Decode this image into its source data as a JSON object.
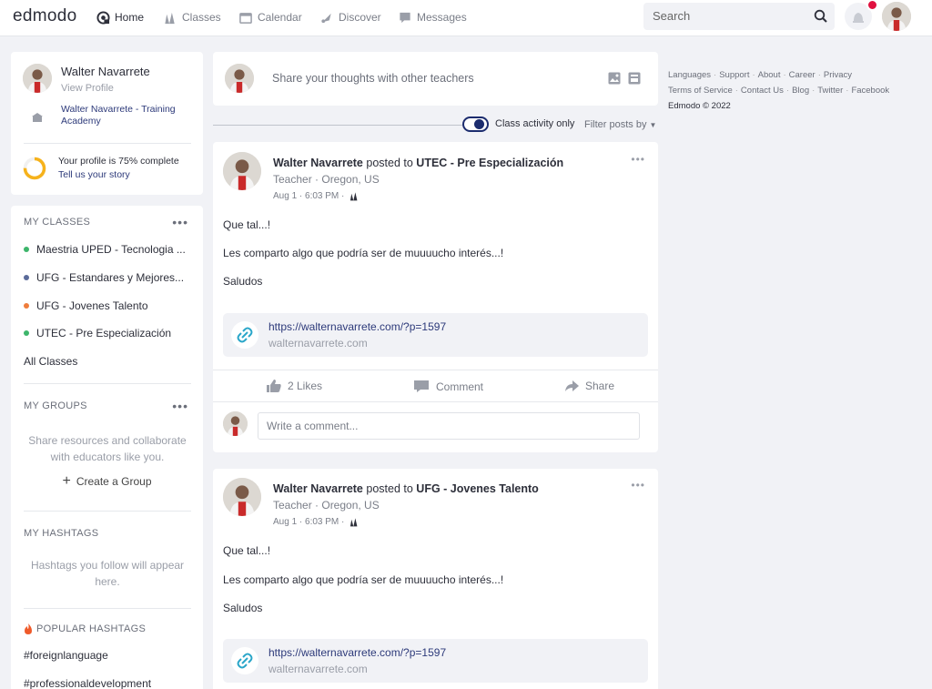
{
  "nav": {
    "logo": "edmodo",
    "items": [
      {
        "label": "Home",
        "icon": "home-icon"
      },
      {
        "label": "Classes",
        "icon": "classes-icon"
      },
      {
        "label": "Calendar",
        "icon": "calendar-icon"
      },
      {
        "label": "Discover",
        "icon": "discover-icon"
      },
      {
        "label": "Messages",
        "icon": "messages-icon"
      }
    ],
    "search_placeholder": "Search"
  },
  "profile": {
    "name": "Walter Navarrete",
    "view_profile": "View Profile",
    "school": "Walter Navarrete - Training Academy",
    "completion_text": "Your profile is 75% complete",
    "completion_percent": 75,
    "completion_cta": "Tell us your story"
  },
  "classes": {
    "title": "MY CLASSES",
    "items": [
      {
        "label": "Maestria UPED - Tecnologia ...",
        "color": "#3db56b"
      },
      {
        "label": "UFG - Estandares y Mejores...",
        "color": "#5b6b9a"
      },
      {
        "label": "UFG - Jovenes Talento",
        "color": "#ef7d3c"
      },
      {
        "label": "UTEC - Pre Especialización",
        "color": "#3db56b"
      }
    ],
    "all_label": "All Classes"
  },
  "groups": {
    "title": "MY GROUPS",
    "empty_text": "Share resources and collaborate with educators like you.",
    "create_label": "Create a Group"
  },
  "hashtags": {
    "title": "MY HASHTAGS",
    "empty_text": "Hashtags you follow will appear here.",
    "popular_title": "POPULAR HASHTAGS",
    "popular": [
      "#foreignlanguage",
      "#professionaldevelopment"
    ]
  },
  "share": {
    "placeholder": "Share your thoughts with other teachers"
  },
  "filter": {
    "toggle_label": "Class activity only",
    "toggle_on": true,
    "filter_label": "Filter posts by"
  },
  "posts": [
    {
      "author": "Walter Navarrete",
      "posted_to": "posted to",
      "target": "UTEC - Pre Especialización",
      "role": "Teacher · Oregon, US",
      "time": "Aug 1 · 6:03 PM ·",
      "lines": [
        "Que tal...!",
        "Les comparto algo que podría ser de muuuucho interés...!",
        "Saludos"
      ],
      "link_url": "https://walternavarrete.com/?p=1597",
      "link_domain": "walternavarrete.com",
      "likes": "2 Likes",
      "comment_label": "Comment",
      "share_label": "Share",
      "comment_placeholder": "Write a comment..."
    },
    {
      "author": "Walter Navarrete",
      "posted_to": "posted to",
      "target": "UFG - Jovenes Talento",
      "role": "Teacher · Oregon, US",
      "time": "Aug 1 · 6:03 PM ·",
      "lines": [
        "Que tal...!",
        "Les comparto algo que podría ser de muuuucho interés...!",
        "Saludos"
      ],
      "link_url": "https://walternavarrete.com/?p=1597",
      "link_domain": "walternavarrete.com"
    }
  ],
  "footer": {
    "links_row1": [
      "Languages",
      "Support",
      "About",
      "Career",
      "Privacy"
    ],
    "links_row2": [
      "Terms of Service",
      "Contact Us",
      "Blog",
      "Twitter",
      "Facebook"
    ],
    "copyright": "Edmodo © 2022"
  }
}
